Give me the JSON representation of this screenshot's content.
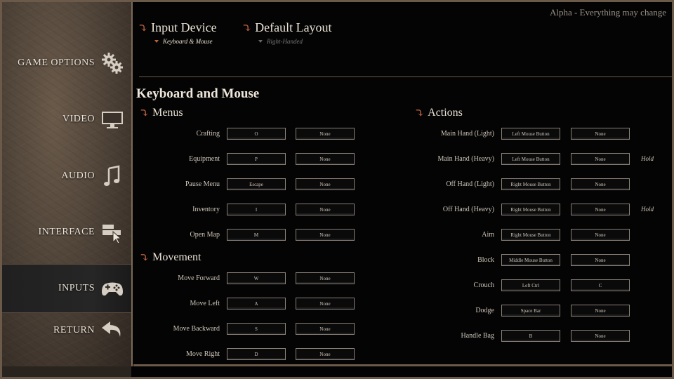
{
  "alpha_note": "Alpha - Everything may change",
  "sidebar": {
    "items": [
      {
        "label": "GAME OPTIONS",
        "icon": "gears-icon"
      },
      {
        "label": "VIDEO",
        "icon": "monitor-icon"
      },
      {
        "label": "AUDIO",
        "icon": "music-note-icon"
      },
      {
        "label": "INTERFACE",
        "icon": "interface-cursor-icon"
      },
      {
        "label": "INPUTS",
        "icon": "gamepad-icon",
        "active": true
      },
      {
        "label": "RETURN",
        "icon": "return-arrow-icon"
      }
    ]
  },
  "header": {
    "input_device": {
      "title": "Input Device",
      "value": "Keyboard & Mouse"
    },
    "default_layout": {
      "title": "Default Layout",
      "value": "Right-Handed"
    }
  },
  "section_title": "Keyboard and Mouse",
  "menus": {
    "title": "Menus",
    "rows": [
      {
        "label": "Crafting",
        "primary": "O",
        "secondary": "None"
      },
      {
        "label": "Equipment",
        "primary": "P",
        "secondary": "None"
      },
      {
        "label": "Pause Menu",
        "primary": "Escape",
        "secondary": "None"
      },
      {
        "label": "Inventory",
        "primary": "I",
        "secondary": "None"
      },
      {
        "label": "Open Map",
        "primary": "M",
        "secondary": "None"
      }
    ]
  },
  "movement": {
    "title": "Movement",
    "rows": [
      {
        "label": "Move Forward",
        "primary": "W",
        "secondary": "None"
      },
      {
        "label": "Move Left",
        "primary": "A",
        "secondary": "None"
      },
      {
        "label": "Move Backward",
        "primary": "S",
        "secondary": "None"
      },
      {
        "label": "Move Right",
        "primary": "D",
        "secondary": "None"
      }
    ]
  },
  "actions": {
    "title": "Actions",
    "rows": [
      {
        "label": "Main Hand (Light)",
        "primary": "Left Mouse Button",
        "secondary": "None",
        "hold": ""
      },
      {
        "label": "Main Hand (Heavy)",
        "primary": "Left Mouse Button",
        "secondary": "None",
        "hold": "Hold"
      },
      {
        "label": "Off Hand (Light)",
        "primary": "Right Mouse Button",
        "secondary": "None",
        "hold": ""
      },
      {
        "label": "Off Hand (Heavy)",
        "primary": "Right Mouse Button",
        "secondary": "None",
        "hold": "Hold"
      },
      {
        "label": "Aim",
        "primary": "Right Mouse Button",
        "secondary": "None",
        "hold": ""
      },
      {
        "label": "Block",
        "primary": "Middle Mouse Button",
        "secondary": "None",
        "hold": ""
      },
      {
        "label": "Crouch",
        "primary": "Left Ctrl",
        "secondary": "C",
        "hold": ""
      },
      {
        "label": "Dodge",
        "primary": "Space Bar",
        "secondary": "None",
        "hold": ""
      },
      {
        "label": "Handle Bag",
        "primary": "B",
        "secondary": "None",
        "hold": ""
      }
    ]
  },
  "colors": {
    "accent": "#b7623f",
    "frame": "#6b5a49"
  }
}
